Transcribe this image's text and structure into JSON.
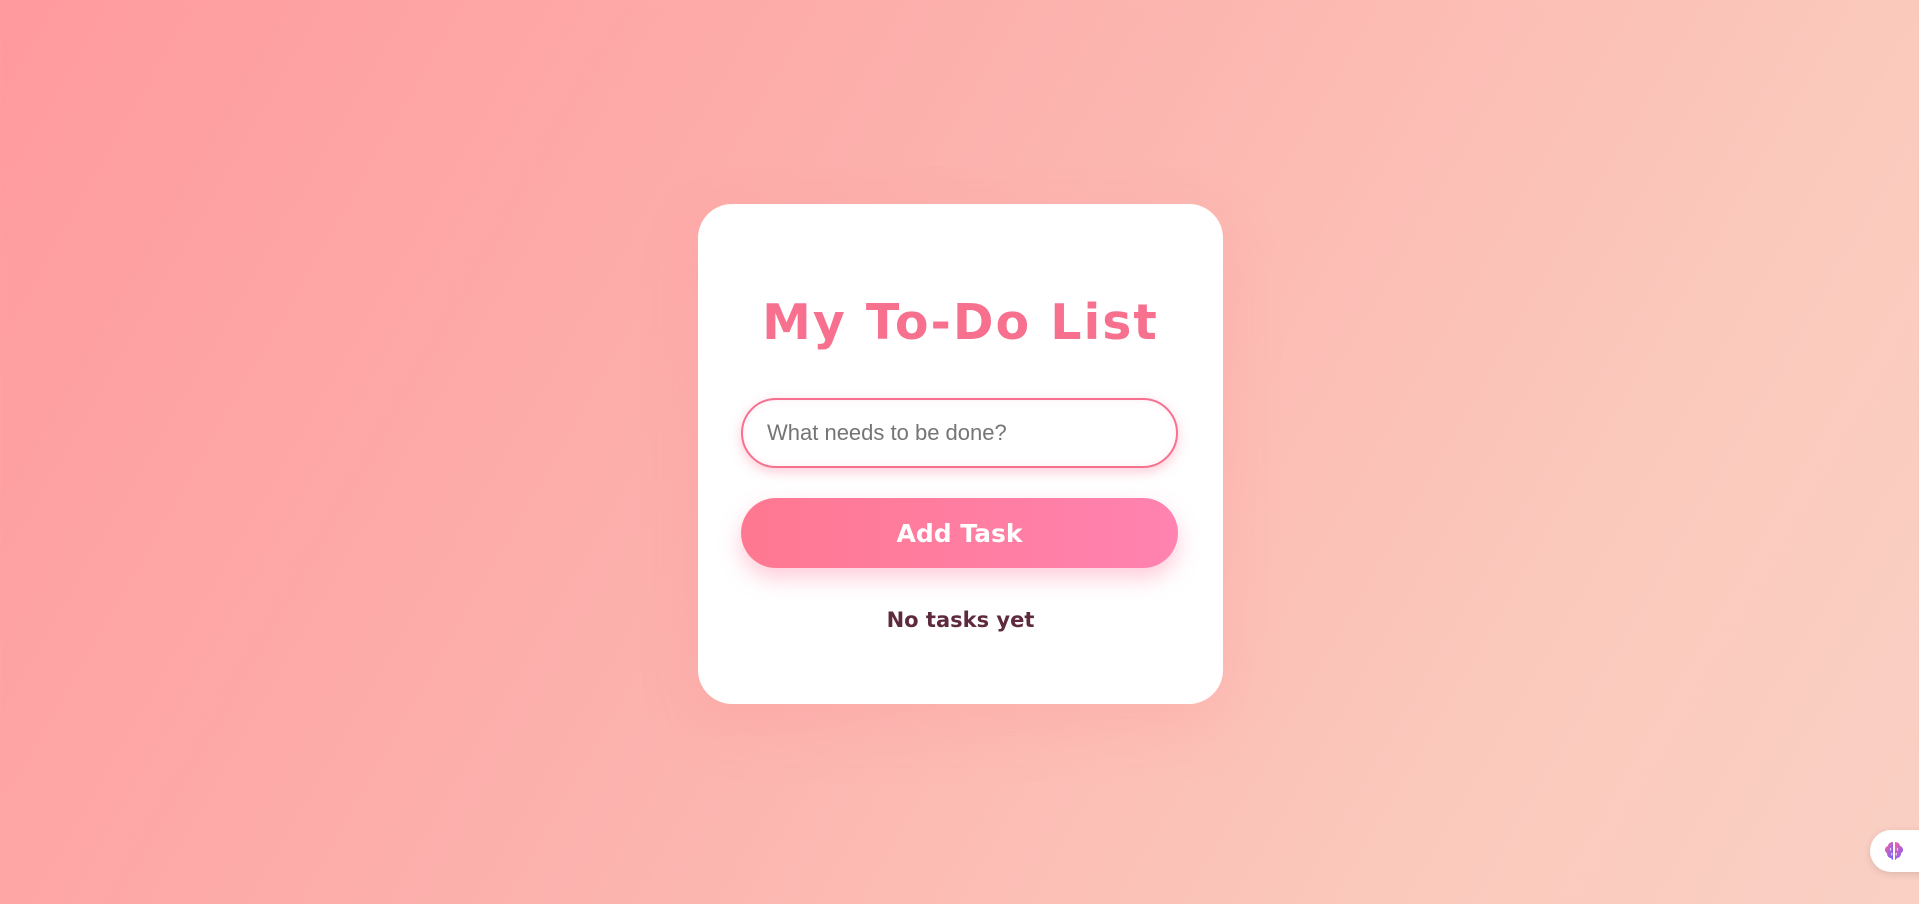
{
  "app": {
    "title": "My To-Do List"
  },
  "task_input": {
    "value": "",
    "placeholder": "What needs to be done?"
  },
  "actions": {
    "add_label": "Add Task"
  },
  "task_list": {
    "empty_message": "No tasks yet",
    "items": []
  },
  "widgets": {
    "assistant_icon": "brain-icon"
  },
  "colors": {
    "accent": "#f7718f",
    "button_gradient_start": "#ff7891",
    "button_gradient_end": "#ff82b0",
    "empty_text": "#5e2a3e",
    "background_start": "#ff9a9e",
    "background_end": "#fad0c4"
  }
}
